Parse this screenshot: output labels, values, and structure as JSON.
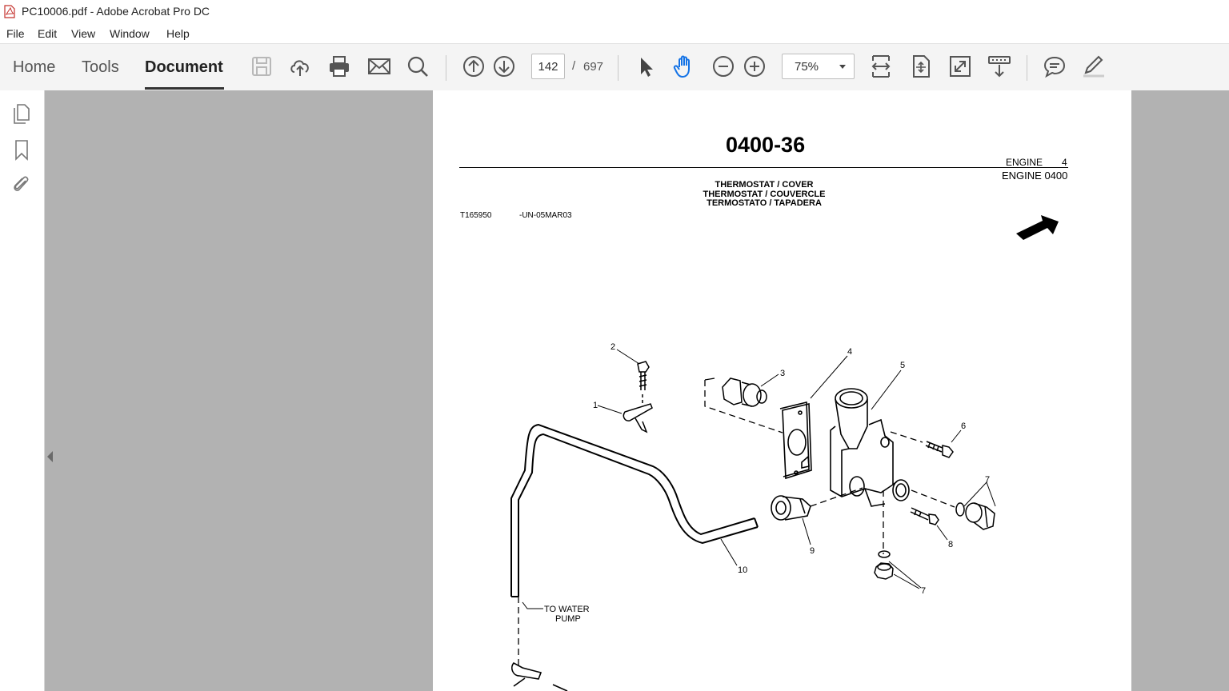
{
  "window": {
    "title": "PC10006.pdf - Adobe Acrobat Pro DC"
  },
  "menu": {
    "items": [
      "File",
      "Edit",
      "View",
      "Window",
      "Help"
    ]
  },
  "toolbar": {
    "tabs": [
      "Home",
      "Tools",
      "Document"
    ],
    "active_tab": "Document",
    "page_current": "142",
    "page_sep": "/",
    "page_total": "697",
    "zoom": "75%",
    "icons": [
      "save-icon",
      "upload-cloud-icon",
      "print-icon",
      "email-icon",
      "search-icon",
      "prev-page-icon",
      "next-page-icon",
      "select-cursor-icon",
      "hand-tool-icon",
      "zoom-out-icon",
      "zoom-in-icon",
      "fit-width-icon",
      "fit-page-icon",
      "fullscreen-icon",
      "scroll-mode-icon",
      "comment-icon",
      "sign-pen-icon"
    ]
  },
  "sidebar": {
    "icons": [
      "pages-thumbnail-icon",
      "bookmark-icon",
      "attachment-icon"
    ]
  },
  "document": {
    "page_number": "0400-36",
    "header_section": "ENGINE",
    "header_section_num": "4",
    "header_group": "ENGINE 0400",
    "subtitles": [
      "THERMOSTAT / COVER",
      "THERMOSTAT / COUVERCLE",
      "TERMOSTATO / TAPADERA"
    ],
    "figure_id": "T165950",
    "figure_date": "-UN-05MAR03",
    "callouts": [
      "1",
      "2",
      "3",
      "4",
      "5",
      "6",
      "7",
      "7",
      "7",
      "8",
      "9",
      "10"
    ],
    "note_line1": "TO WATER",
    "note_line2": "PUMP"
  }
}
